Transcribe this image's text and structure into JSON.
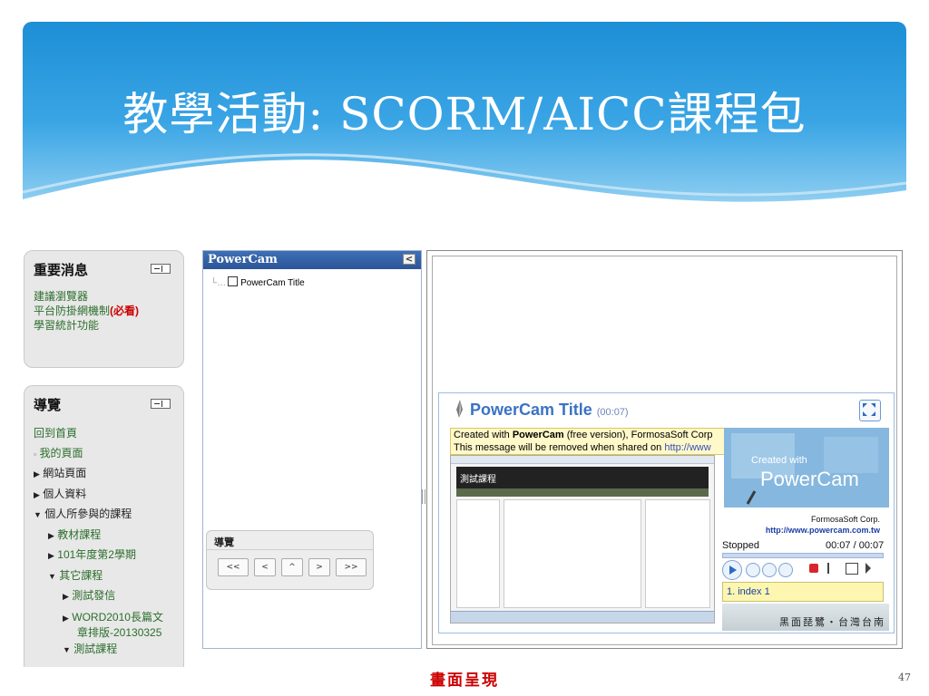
{
  "slide": {
    "title": "教學活動: SCORM/AICC課程包",
    "caption": "畫面呈現",
    "page_number": "47"
  },
  "news_block": {
    "title": "重要消息",
    "links": [
      "建議瀏覽器",
      "平台防掛網機制",
      "(必看)",
      "學習統計功能"
    ]
  },
  "nav_block": {
    "title": "導覽",
    "items": [
      {
        "label": "回到首頁",
        "marker": ""
      },
      {
        "label": "我的頁面",
        "marker": "▫"
      },
      {
        "label": "網站頁面",
        "marker": "▶"
      },
      {
        "label": "個人資料",
        "marker": "▶"
      },
      {
        "label": "個人所參與的課程",
        "marker": "▼"
      },
      {
        "label": "教材課程",
        "marker": "▶"
      },
      {
        "label": "101年度第2學期",
        "marker": "▶"
      },
      {
        "label": "其它課程",
        "marker": "▼"
      },
      {
        "label": "測試發信",
        "marker": "▶"
      },
      {
        "label": "WORD2010長篇文",
        "marker": "▶"
      },
      {
        "label": "章排版-20130325",
        "marker": ""
      },
      {
        "label": "測試課程",
        "marker": "▼"
      }
    ]
  },
  "tree_pane": {
    "header": "PowerCam",
    "close_label": "<",
    "node_label": "PowerCam Title"
  },
  "nav_mini": {
    "title": "導覽",
    "buttons": [
      "<<",
      "<",
      "^",
      ">",
      ">>"
    ]
  },
  "player": {
    "title": "PowerCam Title",
    "duration": "(00:07)",
    "message_line1_a": "Created with ",
    "message_line1_b": "PowerCam",
    "message_line1_c": " (free version), FormosaSoft Corp",
    "message_line2_a": "This message will be removed when shared on ",
    "message_line2_link": "http://www",
    "screen_header": "測試課程",
    "media_created": "Created with",
    "media_product": "PowerCam",
    "media_company": "FormosaSoft Corp.",
    "media_url": "http://www.powercam.com.tw",
    "status": "Stopped",
    "time": "00:07 / 00:07",
    "index_item": "1. index 1",
    "logo_text": "黑面琵鷺・台灣台南"
  }
}
